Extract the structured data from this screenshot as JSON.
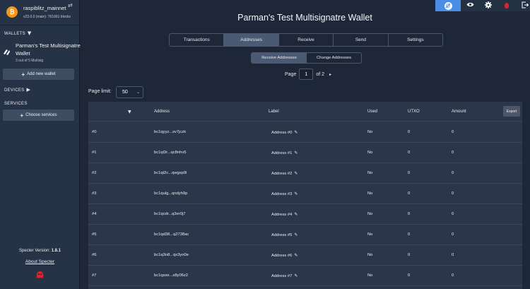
{
  "node": {
    "name": "raspiblitz_mainnet",
    "version": "v23.0.0 (main): 761661 blocks",
    "logo_glyph": "₿",
    "switch_icon": "⇄"
  },
  "sidebar": {
    "wallets_title": "WALLETS",
    "wallets_arrow": "▼",
    "wallet": {
      "name": "Parman's Test Multisignatre Wallet",
      "desc": "3 out of 5 Multisig",
      "icon": "multisig-icon"
    },
    "add_wallet_label": "Add new wallet",
    "devices_title": "DEVICES",
    "devices_arrow": "▶",
    "services_title": "SERVICES",
    "choose_services_label": "Choose services",
    "version_label": "Specter Version:",
    "version_value": "1.8.1",
    "about_label": "About Specter",
    "plus": "+"
  },
  "toolbar": {
    "items": [
      "tor-icon",
      "eye-icon",
      "gear-icon",
      "hwi-bridge-icon",
      "logout-icon"
    ],
    "colors": {
      "active": "#4a8fe5",
      "alert": "#d8262f"
    }
  },
  "main": {
    "title": "Parman's Test Multisignatre Wallet",
    "tabs": [
      "Transactions",
      "Addresses",
      "Receive",
      "Send",
      "Settings"
    ],
    "active_tab": "Addresses",
    "subtabs": [
      "Receive Addresses",
      "Change Addresses"
    ],
    "active_subtab": "Receive Addresses",
    "pager": {
      "page_label": "Page",
      "current": "1",
      "of_label": "of 2",
      "next": "▸"
    },
    "page_limit_label": "Page limit:",
    "page_limit_value": "50",
    "chevron": "⌄"
  },
  "table": {
    "sort_arrow": "▼",
    "headers": {
      "address": "Address",
      "label": "Label",
      "used": "Used",
      "utxo": "UTXO",
      "amount": "Amount"
    },
    "export_label": "Export",
    "rows": [
      {
        "index": "#0",
        "address": "bc1qyyz...sv7jczk",
        "label": "Address #0",
        "used": "No",
        "utxo": "0",
        "amount": "0"
      },
      {
        "index": "#1",
        "address": "bc1ql3r...qc8nhv5",
        "label": "Address #1",
        "used": "No",
        "utxo": "0",
        "amount": "0"
      },
      {
        "index": "#2",
        "address": "bc1qt2c...qwgsp9l",
        "label": "Address #2",
        "used": "No",
        "utxo": "0",
        "amount": "0"
      },
      {
        "index": "#3",
        "address": "bc1qulg...qndyh9p",
        "label": "Address #3",
        "used": "No",
        "utxo": "0",
        "amount": "0"
      },
      {
        "index": "#4",
        "address": "bc1qcdr...q3er0j7",
        "label": "Address #4",
        "used": "No",
        "utxo": "0",
        "amount": "0"
      },
      {
        "index": "#5",
        "address": "bc1qd38...q2738ac",
        "label": "Address #5",
        "used": "No",
        "utxo": "0",
        "amount": "0"
      },
      {
        "index": "#6",
        "address": "bc1q3n8...qx3yn0e",
        "label": "Address #6",
        "used": "No",
        "utxo": "0",
        "amount": "0"
      },
      {
        "index": "#7",
        "address": "bc1qsxe...s8y06z2",
        "label": "Address #7",
        "used": "No",
        "utxo": "0",
        "amount": "0"
      }
    ],
    "edit_glyph": "✎"
  }
}
